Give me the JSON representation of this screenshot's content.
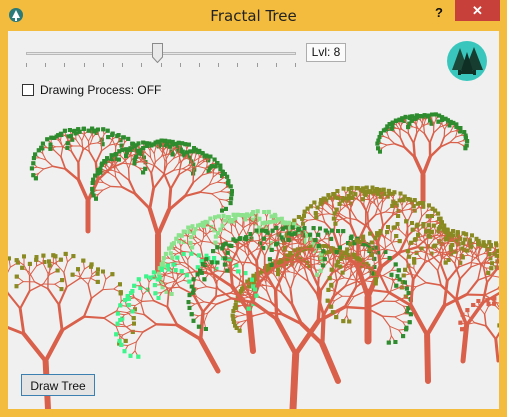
{
  "window": {
    "title": "Fractal Tree",
    "help_label": "?",
    "close_label": "✕"
  },
  "controls": {
    "level_label": "Lvl: 8",
    "level_value": 8,
    "drawing_process_label": "Drawing Process: OFF",
    "drawing_process_checked": false,
    "draw_button_label": "Draw Tree"
  },
  "icons": {
    "app_icon": "tree-app-icon",
    "logo": "pine-trees-logo"
  },
  "colors": {
    "titlebar": "#f3bc3e",
    "close_button": "#c7403a",
    "trunk": "#d9604a",
    "leaf_dark_green": "#2e8b2e",
    "leaf_olive": "#8a8a22",
    "leaf_light_green": "#8de38d",
    "leaf_mint": "#3df58a",
    "background": "#f0f0f0"
  }
}
